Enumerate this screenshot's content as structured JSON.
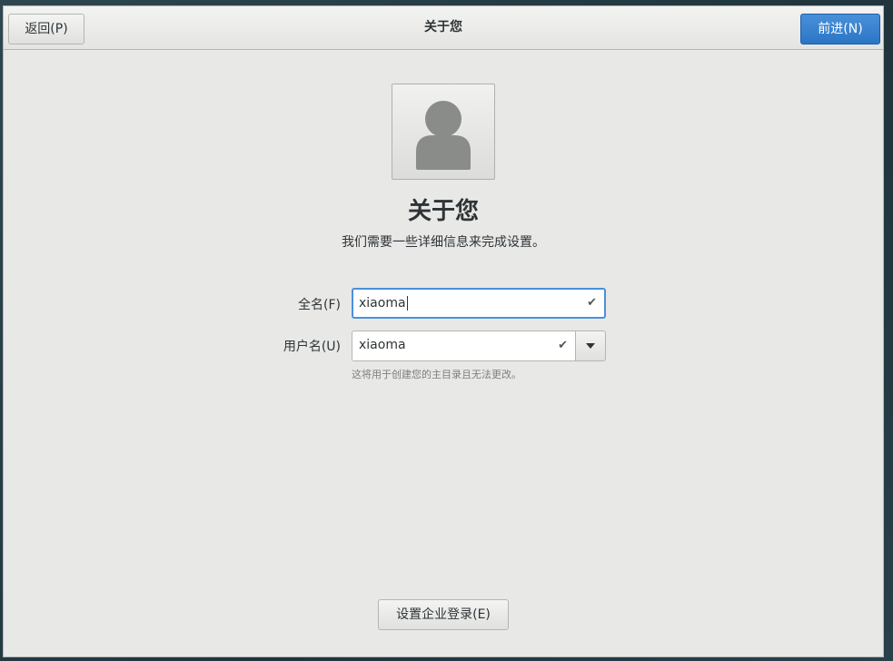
{
  "header": {
    "back_label": "返回(P)",
    "title": "关于您",
    "next_label": "前进(N)"
  },
  "main": {
    "avatar_icon": "user-avatar-icon",
    "title": "关于您",
    "subtitle": "我们需要一些详细信息来完成设置。"
  },
  "form": {
    "fullname_label": "全名(F)",
    "fullname_value": "xiaoma",
    "username_label": "用户名(U)",
    "username_value": "xiaoma",
    "username_hint": "这将用于创建您的主目录且无法更改。",
    "valid_icon": "checkmark-icon",
    "dropdown_icon": "chevron-down-icon"
  },
  "footer": {
    "enterprise_login_label": "设置企业登录(E)"
  },
  "colors": {
    "accent": "#2a76c6",
    "focus_border": "#4a90d9",
    "window_bg": "#e8e8e7"
  }
}
